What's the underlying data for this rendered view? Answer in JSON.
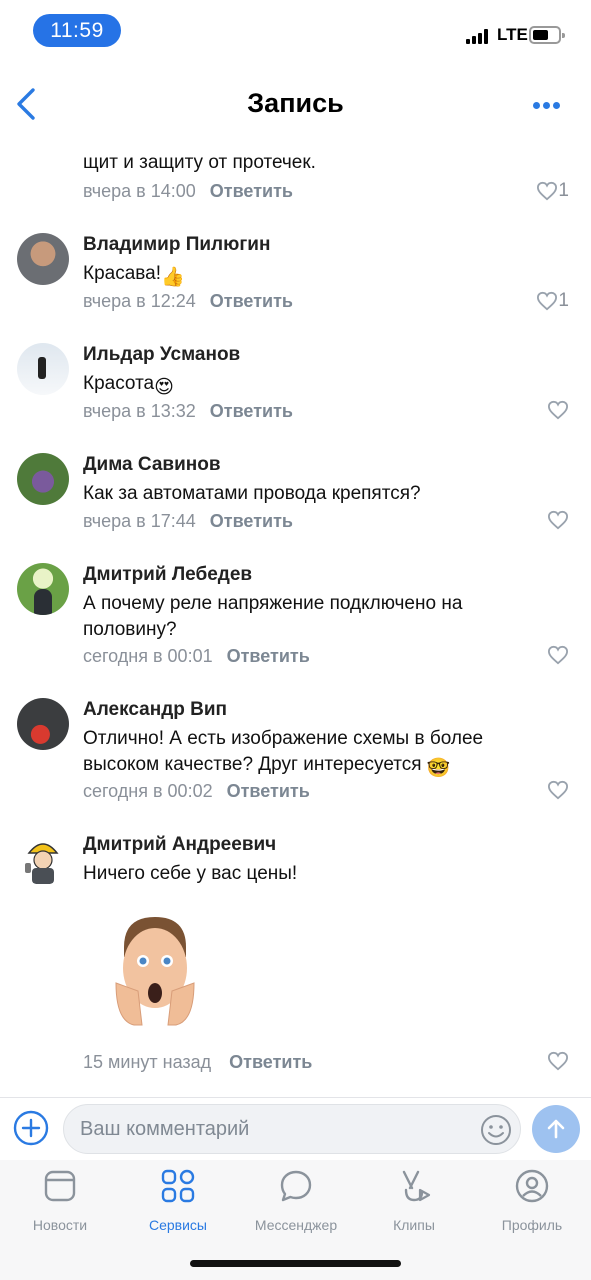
{
  "status_bar": {
    "time": "11:59",
    "network": "LTE"
  },
  "header": {
    "title": "Запись"
  },
  "comments": [
    {
      "name": "",
      "text": "щит и защиту от протечек.",
      "time": "вчера в 14:00",
      "reply": "Ответить",
      "likes": "1",
      "liked_count_shown": true
    },
    {
      "name": "Владимир Пилюгин",
      "text": "Красава!",
      "emoji": "👍",
      "time": "вчера в 12:24",
      "reply": "Ответить",
      "likes": "1"
    },
    {
      "name": "Ильдар Усманов",
      "text": "Красота",
      "emoji": "😍",
      "time": "вчера в 13:32",
      "reply": "Ответить",
      "likes": ""
    },
    {
      "name": "Дима Савинов",
      "text": "Как за автоматами провода крепятся?",
      "time": "вчера в 17:44",
      "reply": "Ответить",
      "likes": ""
    },
    {
      "name": "Дмитрий Лебедев",
      "text": "А почему реле напряжение подключено на половину?",
      "time": "сегодня в 00:01",
      "reply": "Ответить",
      "likes": ""
    },
    {
      "name": "Александр Вип",
      "text": "Отлично! А есть изображение схемы в более высоком качестве? Друг интересуется",
      "emoji": "🤓",
      "time": "сегодня в 00:02",
      "reply": "Ответить",
      "likes": ""
    },
    {
      "name": "Дмитрий Андреевич",
      "text": "Ничего себе у вас цены!",
      "time": "15 минут назад",
      "reply": "Ответить",
      "likes": ""
    }
  ],
  "composer": {
    "placeholder": "Ваш комментарий"
  },
  "tabs": [
    {
      "label": "Новости",
      "icon": "news-icon"
    },
    {
      "label": "Сервисы",
      "icon": "services-icon",
      "active": true
    },
    {
      "label": "Мессенджер",
      "icon": "messenger-icon"
    },
    {
      "label": "Клипы",
      "icon": "clips-icon"
    },
    {
      "label": "Профиль",
      "icon": "profile-icon"
    }
  ],
  "colors": {
    "accent": "#2a7ae2",
    "time_pill": "#2673e6",
    "send_disabled": "#9ec2f0",
    "meta": "#8a9099"
  }
}
